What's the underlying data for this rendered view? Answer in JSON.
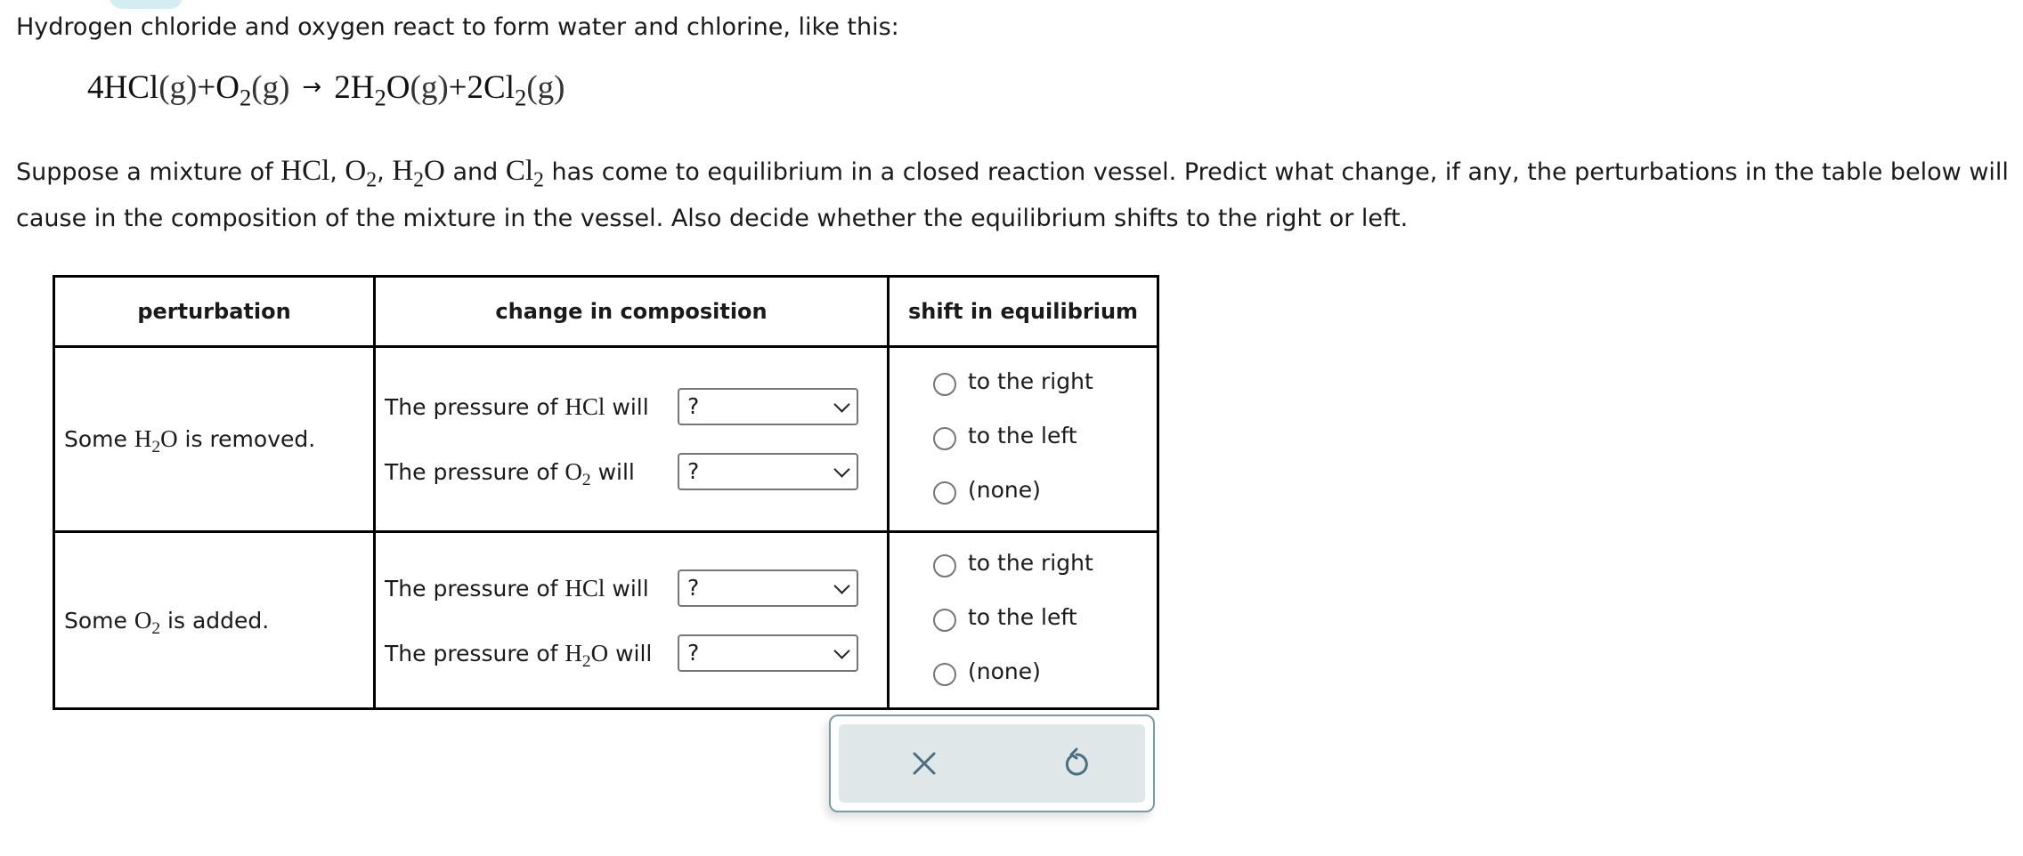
{
  "intro": "Hydrogen chloride and oxygen react to form water and chlorine, like this:",
  "equation": {
    "reactants": [
      {
        "coef": "4",
        "formula": "HCl",
        "sub": "",
        "phase": "(g)"
      },
      {
        "coef": "",
        "formula": "O",
        "sub": "2",
        "phase": "(g)"
      }
    ],
    "arrow": "→",
    "products": [
      {
        "coef": "2",
        "formula_a": "H",
        "sub": "2",
        "formula_b": "O",
        "phase": "(g)"
      },
      {
        "coef": "2",
        "formula": "Cl",
        "sub": "2",
        "phase": "(g)"
      }
    ],
    "plus": "+"
  },
  "paragraph": {
    "part1": "Suppose a mixture of ",
    "hcl": "HCl",
    "comma1": ", ",
    "o2": "O",
    "o2_sub": "2",
    "comma2": ", ",
    "h2o_a": "H",
    "h2o_sub": "2",
    "h2o_b": "O",
    "and": " and ",
    "cl2": "Cl",
    "cl2_sub": "2",
    "part2": " has come to equilibrium in a closed reaction vessel. Predict what change, if any, the perturbations in the table below will cause in the composition of the mixture in the vessel. Also decide whether the equilibrium shifts to the right or left."
  },
  "table": {
    "headers": [
      "perturbation",
      "change in composition",
      "shift in equilibrium"
    ],
    "rows": [
      {
        "perturbation": {
          "pre": "Some ",
          "chem_a": "H",
          "chem_sub": "2",
          "chem_b": "O",
          "post": " is removed."
        },
        "changes": [
          {
            "pre": "The pressure of ",
            "chem_a": "HCl",
            "chem_sub": "",
            "chem_b": "",
            "post": " will",
            "selected": "?"
          },
          {
            "pre": "The pressure of ",
            "chem_a": "O",
            "chem_sub": "2",
            "chem_b": "",
            "post": " will",
            "selected": "?"
          }
        ],
        "shift_options": [
          "to the right",
          "to the left",
          "(none)"
        ],
        "shift_selected": null
      },
      {
        "perturbation": {
          "pre": "Some ",
          "chem_a": "O",
          "chem_sub": "2",
          "chem_b": "",
          "post": " is added."
        },
        "changes": [
          {
            "pre": "The pressure of ",
            "chem_a": "HCl",
            "chem_sub": "",
            "chem_b": "",
            "post": " will",
            "selected": "?"
          },
          {
            "pre": "The pressure of ",
            "chem_a": "H",
            "chem_sub": "2",
            "chem_b": "O",
            "post": " will",
            "selected": "?"
          }
        ],
        "shift_options": [
          "to the right",
          "to the left",
          "(none)"
        ],
        "shift_selected": null
      }
    ]
  },
  "actions": {
    "clear_icon": "x-icon",
    "undo_icon": "undo-icon",
    "icon_color": "#4a7080",
    "panel_border": "#7a9aa5",
    "panel_fill": "#e0e7e9"
  },
  "top_tab_color": "#d3eef2"
}
